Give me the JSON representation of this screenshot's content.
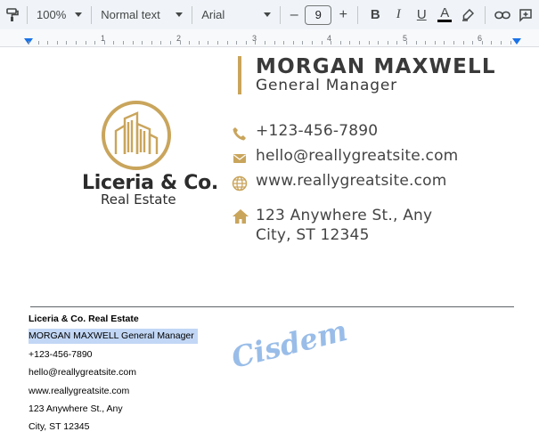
{
  "toolbar": {
    "zoom": "100%",
    "style": "Normal text",
    "font": "Arial",
    "font_size": "9",
    "minus": "–",
    "plus": "+",
    "bold": "B",
    "italic": "I",
    "underline": "U",
    "text_color": "A"
  },
  "ruler": {
    "numbers": [
      "1",
      "2",
      "3",
      "4",
      "5",
      "6"
    ]
  },
  "card": {
    "brand_name": "Liceria & Co.",
    "brand_sub": "Real Estate",
    "person_name": "MORGAN MAXWELL",
    "person_title": "General Manager",
    "phone": "+123-456-7890",
    "email": "hello@reallygreatsite.com",
    "website": "www.reallygreatsite.com",
    "address_line1": "123 Anywhere St., Any",
    "address_line2": "City, ST 12345",
    "accent_color": "#c9a55c"
  },
  "doc": {
    "line1": "Liceria & Co. Real Estate",
    "line2": "MORGAN MAXWELL General Manager",
    "line3": "+123-456-7890",
    "line4": "hello@reallygreatsite.com",
    "line5": "www.reallygreatsite.com",
    "line6": "123 Anywhere St., Any",
    "line7": "City, ST 12345"
  },
  "watermark": "Cisdem"
}
